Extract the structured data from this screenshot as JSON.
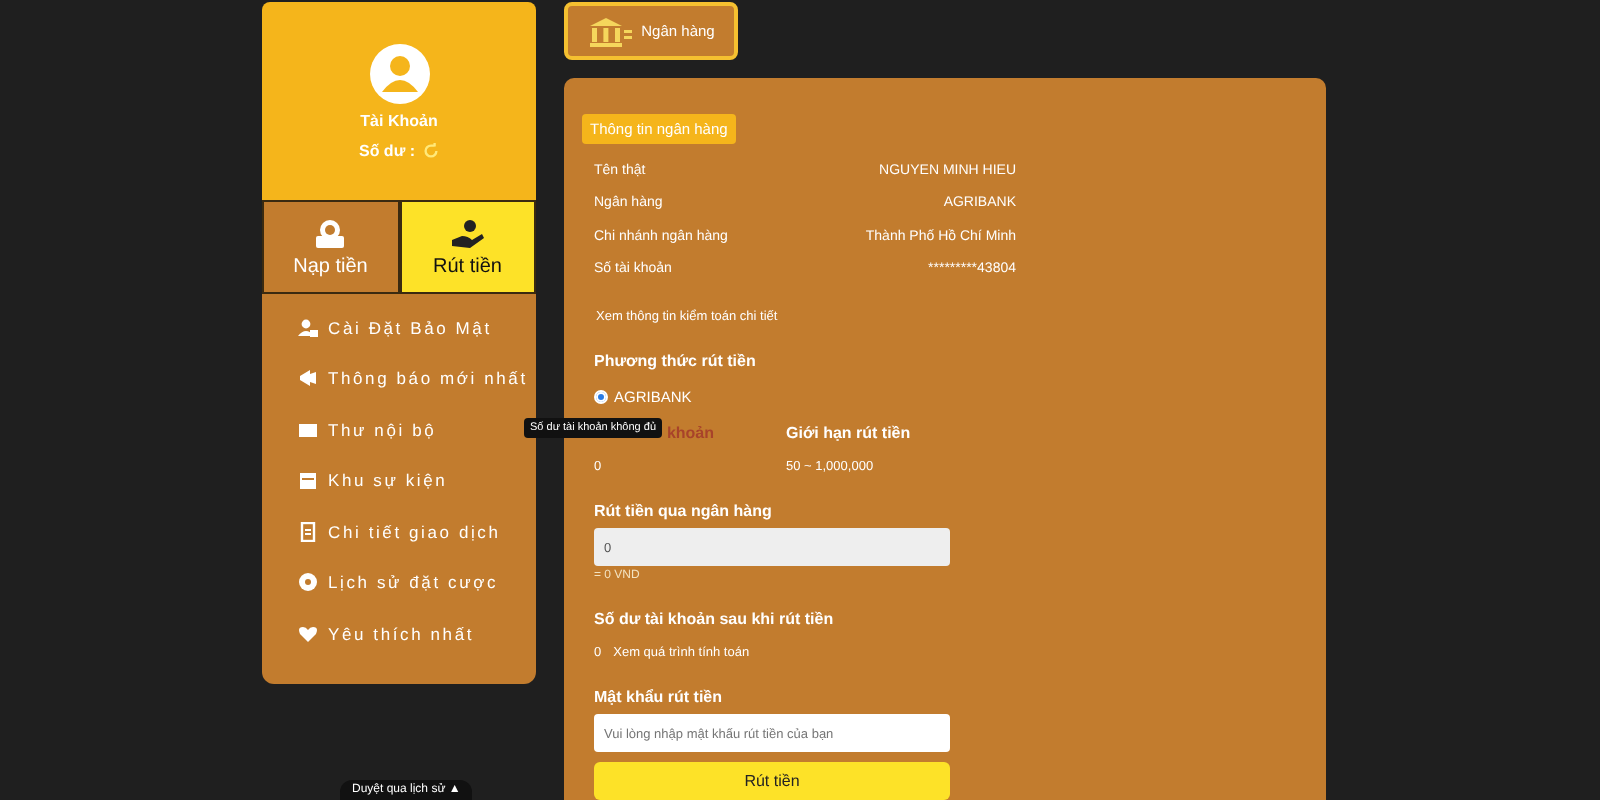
{
  "account": {
    "title": "Tài Khoản",
    "balance_label": "Số dư :"
  },
  "actions": [
    {
      "label": "Nạp tiền",
      "selected": false
    },
    {
      "label": "Rút tiền",
      "selected": true
    }
  ],
  "menu": [
    {
      "label": "Cài Đặt Bảo Mật"
    },
    {
      "label": "Thông báo mới nhất"
    },
    {
      "label": "Thư nội bộ"
    },
    {
      "label": "Khu sự kiện"
    },
    {
      "label": "Chi tiết giao dịch"
    },
    {
      "label": "Lịch sử đặt cược"
    },
    {
      "label": "Yêu thích nhất"
    }
  ],
  "tab": {
    "label": "Ngân hàng"
  },
  "bank_info": {
    "badge": "Thông tin ngân hàng",
    "rows": [
      {
        "label": "Tên thật",
        "value": "NGUYEN MINH HIEU"
      },
      {
        "label": "Ngân hàng",
        "value": "AGRIBANK"
      },
      {
        "label": "Chi nhánh ngân hàng",
        "value": "Thành Phố Hồ Chí Minh"
      },
      {
        "label": "Số tài khoản",
        "value": "*********43804"
      }
    ],
    "detail_link": "Xem thông tin kiểm toán chi tiết"
  },
  "withdraw_method": {
    "title": "Phương thức rút tiền",
    "options": [
      {
        "label": "AGRIBANK",
        "selected": true
      }
    ]
  },
  "balance": {
    "label": "khoản",
    "value": "0",
    "tooltip": "Số dư tài khoản không đủ"
  },
  "limit": {
    "label": "Giới hạn rút tiền",
    "value": "50 ~ 1,000,000"
  },
  "amount": {
    "label": "Rút tiền qua ngân hàng",
    "value": "0",
    "converted": "= 0 VND"
  },
  "after_balance": {
    "label": "Số dư tài khoản sau khi rút tiền",
    "value": "0",
    "link": "Xem quá trình tính toán"
  },
  "password": {
    "label": "Mật khẩu rút tiền",
    "placeholder": "Vui lòng nhập mật khẩu rút tiền của bạn"
  },
  "submit": "Rút tiền",
  "history_bar": "Duyệt qua lịch sử ▲"
}
